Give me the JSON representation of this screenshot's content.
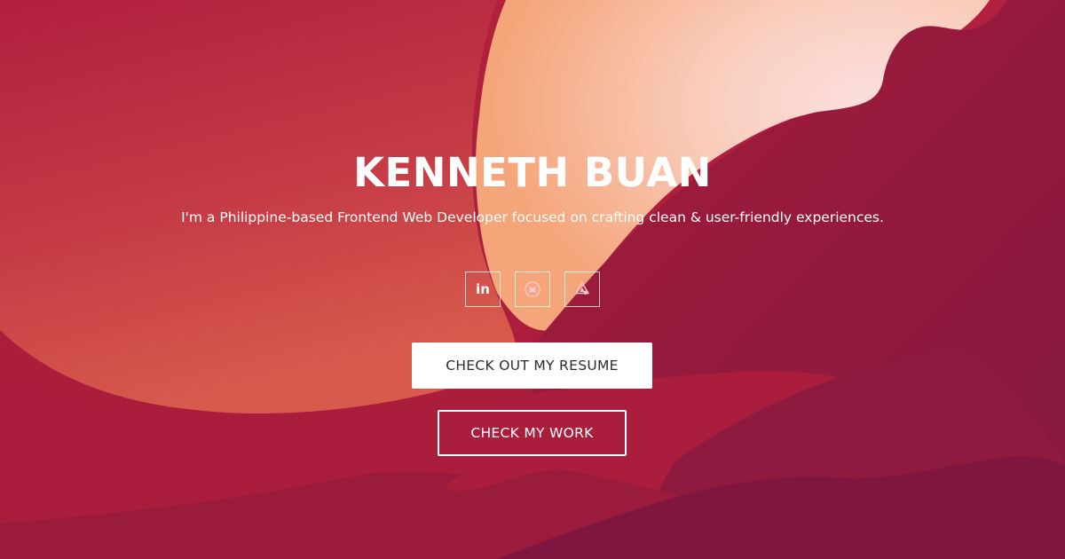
{
  "hero": {
    "title": "KENNETH BUAN",
    "subtitle": "I'm a Philippine-based Frontend Web Developer focused on crafting clean & user-friendly experiences."
  },
  "social": [
    {
      "icon": "linkedin-icon",
      "glyph": "in"
    },
    {
      "icon": "github-icon"
    },
    {
      "icon": "codepen-icon"
    }
  ],
  "buttons": {
    "resume_label": "CHECK OUT MY RESUME",
    "work_label": "CHECK MY WORK"
  },
  "colors": {
    "background": "#ad1f3b",
    "sun_light": "#fbd9d5",
    "sun_warm": "#f7b27f",
    "mountain_dark": "#7e1640",
    "text": "#ffffff",
    "button_text": "#2b2b2b"
  }
}
